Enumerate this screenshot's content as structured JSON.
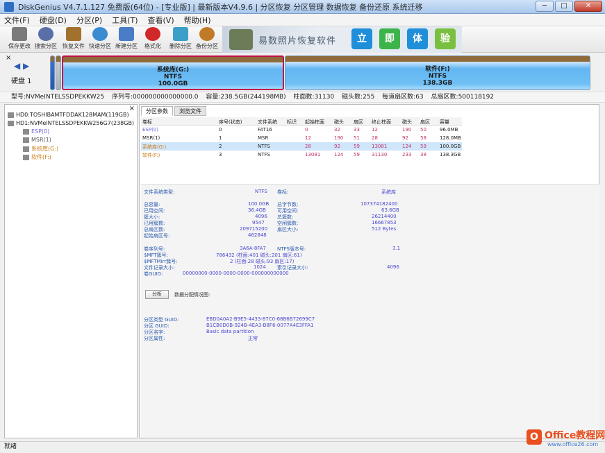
{
  "window": {
    "title": "DiskGenius V4.7.1.127 免费版(64位) - [专业版] | 最新版本V4.9.6 | 分区恢复 分区管理 数据恢复 备份还原 系统迁移",
    "minimize": "─",
    "maximize": "□",
    "close": "✕"
  },
  "menu": [
    "文件(F)",
    "硬盘(D)",
    "分区(P)",
    "工具(T)",
    "查看(V)",
    "帮助(H)"
  ],
  "toolbar": {
    "buttons": [
      {
        "label": "保存更改",
        "icon": "save-disk-icon",
        "color": "#7a7a7a"
      },
      {
        "label": "搜索分区",
        "icon": "search-icon",
        "color": "#5a6ea8"
      },
      {
        "label": "恢复文件",
        "icon": "recover-files-icon",
        "color": "#a0722c"
      },
      {
        "label": "快速分区",
        "icon": "quick-partition-icon",
        "color": "#3a8bd0"
      },
      {
        "label": "新建分区",
        "icon": "new-partition-icon",
        "color": "#4a7cc8"
      },
      {
        "label": "格式化",
        "icon": "format-icon",
        "color": "#d02828"
      },
      {
        "label": "删除分区",
        "icon": "delete-partition-icon",
        "color": "#3aa0c8"
      },
      {
        "label": "备份分区",
        "icon": "backup-partition-icon",
        "color": "#c07a28"
      }
    ],
    "banner": {
      "text": "易数照片恢复软件",
      "buttons": [
        {
          "label": "立",
          "color": "#1e8fd8"
        },
        {
          "label": "即",
          "color": "#3cb44a"
        },
        {
          "label": "体",
          "color": "#1e8fd8"
        },
        {
          "label": "验",
          "color": "#7ac040"
        }
      ]
    }
  },
  "diskmap": {
    "close": "×",
    "arrows": "◀ ▶",
    "disk_label": "硬盘 1",
    "partitions": [
      {
        "name": "系统库(G:)",
        "fs": "NTFS",
        "size": "100.0GB",
        "selected": true
      },
      {
        "name": "软件(F:)",
        "fs": "NTFS",
        "size": "138.3GB",
        "selected": false
      }
    ]
  },
  "infobar": {
    "model": "型号:NVMeINTELSSDPEKKW25",
    "serial": "序列号:000000000000000.0",
    "capacity": "容量:238.5GB(244198MB)",
    "cylinders": "柱面数:31130",
    "heads": "磁头数:255",
    "sectors_per_track": "每道扇区数:63",
    "total_sectors": "总扇区数:500118192"
  },
  "tree": {
    "close": "×",
    "rows": [
      {
        "text": "HD0:TOSHIBAMTFDDAK128MAM(119GB)",
        "kind": "disk"
      },
      {
        "text": "HD1:NVMeINTELSSDPEKKW256G7(238GB)",
        "kind": "disk"
      },
      {
        "text": "ESP(0)",
        "kind": "part1"
      },
      {
        "text": "MSR(1)",
        "kind": "part2"
      },
      {
        "text": "系统库(G:)",
        "kind": "part3"
      },
      {
        "text": "软件(F:)",
        "kind": "part3"
      }
    ]
  },
  "tabs": [
    "分区参数",
    "浏览文件"
  ],
  "partition_table": {
    "headers": [
      "卷标",
      "序号(状态)",
      "文件系统",
      "标识",
      "起始柱面",
      "磁头",
      "扇区",
      "终止柱面",
      "磁头",
      "扇区",
      "容量"
    ],
    "rows": [
      [
        "ESP(0)",
        "0",
        "FAT16",
        "",
        "0",
        "32",
        "33",
        "12",
        "190",
        "50",
        "96.0MB"
      ],
      [
        "MSR(1)",
        "1",
        "MSR",
        "",
        "12",
        "190",
        "51",
        "28",
        "92",
        "58",
        "128.0MB"
      ],
      [
        "系统库(G:)",
        "2",
        "NTFS",
        "",
        "28",
        "92",
        "59",
        "13081",
        "124",
        "59",
        "100.0GB"
      ],
      [
        "软件(F:)",
        "3",
        "NTFS",
        "",
        "13081",
        "124",
        "59",
        "31130",
        "233",
        "38",
        "138.3GB"
      ]
    ]
  },
  "details": {
    "fs_type_label": "文件系统类型:",
    "fs_type_value": "NTFS",
    "volume_label_label": "卷标:",
    "volume_label_value": "系统库",
    "left_pairs": [
      [
        "总容量:",
        "100.0GB"
      ],
      [
        "已用空间:",
        "36.4GB"
      ],
      [
        "簇大小:",
        "4096"
      ],
      [
        "已用簇数:",
        "9547"
      ],
      [
        "总扇区数:",
        "209715200"
      ],
      [
        "起始扇区号:",
        "462848"
      ]
    ],
    "right_pairs": [
      [
        "总字节数:",
        "107374182400"
      ],
      [
        "可用空间:",
        "63.6GB"
      ],
      [
        "总簇数:",
        "26214400"
      ],
      [
        "空闲簇数:",
        "16667853"
      ],
      [
        "扇区大小:",
        "512 Bytes"
      ]
    ],
    "bottom_pairs": [
      [
        "卷序列号:",
        "3A6A-8FA7"
      ],
      [
        "$MFT簇号:",
        "786432 (柱面:401 磁头:201 扇区:61)"
      ],
      [
        "$MFTMirr簇号:",
        "2 (柱面:28 磁头:93 扇区:17)"
      ],
      [
        "文件记录大小:",
        "1024"
      ],
      [
        "卷GUID:",
        "00000000-0000-0000-0000-000000000000"
      ]
    ],
    "bottom_right_pairs": [
      [
        "NTFS版本号:",
        "3.1"
      ],
      [
        "索引记录大小:",
        "4096"
      ]
    ],
    "analyze_button": "分析",
    "analyze_note": "数据分配情况图:",
    "guid_pairs": [
      [
        "分区类型 GUID:",
        "EBD0A0A2-B9E5-4433-87C0-68B6B72699C7"
      ],
      [
        "分区 GUID:",
        "B1CB0D0B-924B-4EA3-B8F6-0077A4E3FFA1"
      ],
      [
        "分区名字:",
        "Basic data partition"
      ],
      [
        "分区属性:",
        "正常"
      ]
    ]
  },
  "statusbar": "就绪",
  "watermark": {
    "logo": "O",
    "text": "Office教程网",
    "url": "www.office26.com"
  }
}
